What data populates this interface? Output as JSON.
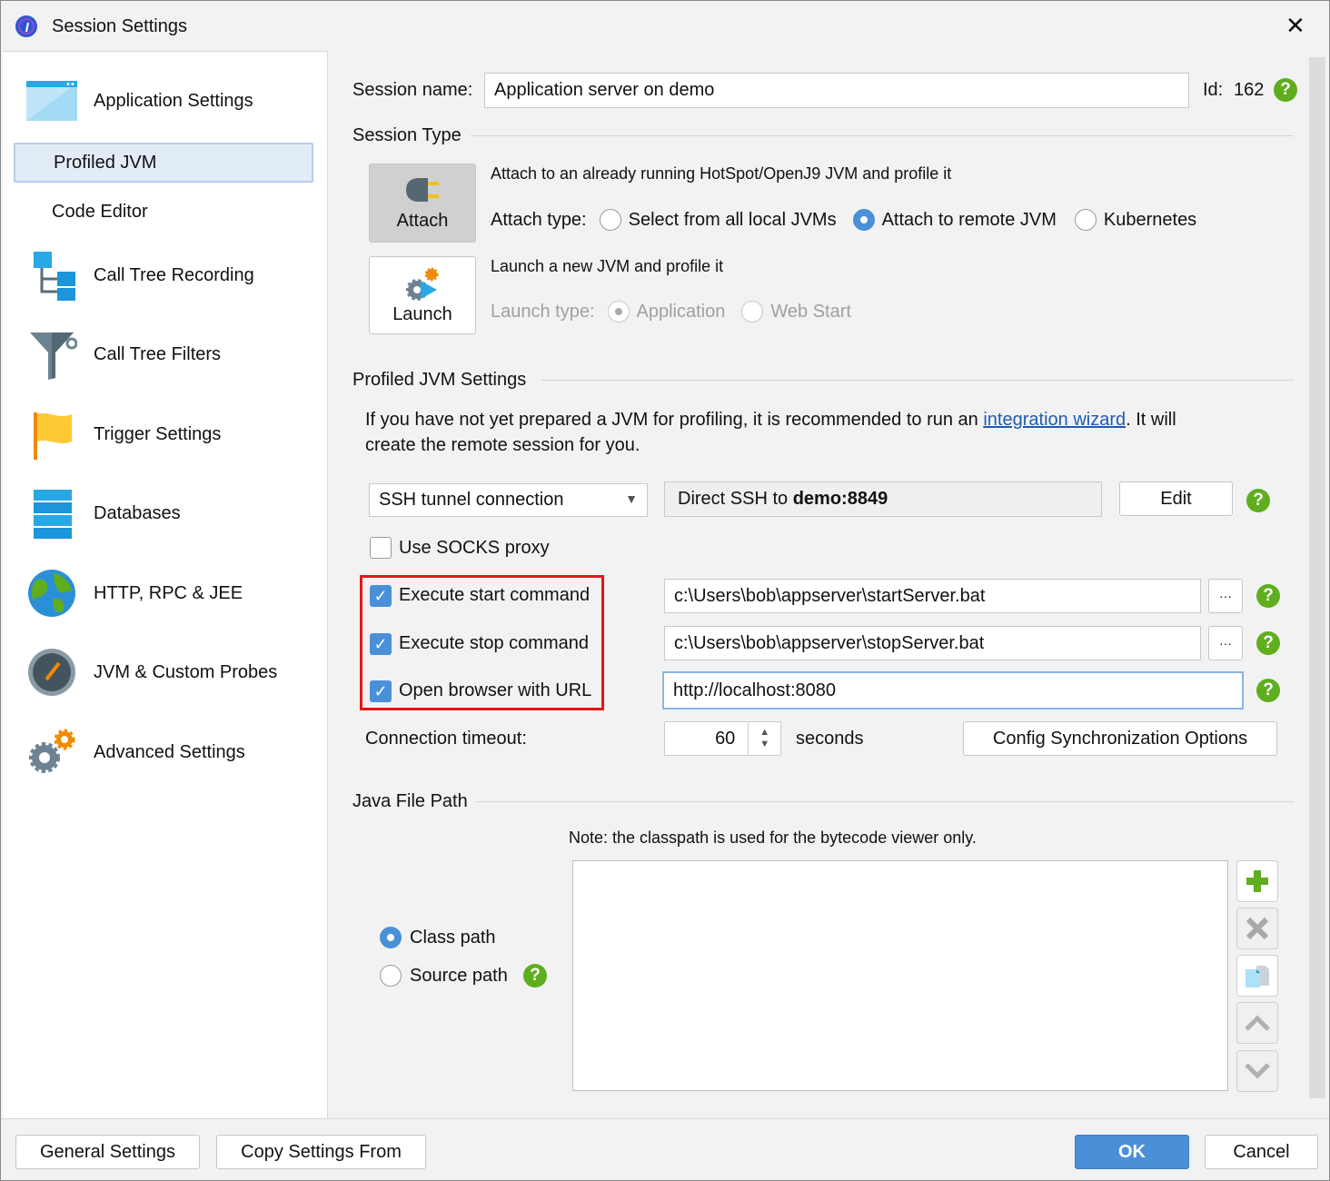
{
  "window": {
    "title": "Session Settings",
    "close": "✕"
  },
  "sidebar": {
    "items": [
      {
        "label": "Application Settings",
        "icon": "application-window-icon"
      },
      {
        "label": "Profiled JVM",
        "selected": true
      },
      {
        "label": "Code Editor"
      },
      {
        "label": "Call Tree Recording",
        "icon": "call-tree-icon"
      },
      {
        "label": "Call Tree Filters",
        "icon": "funnel-icon"
      },
      {
        "label": "Trigger Settings",
        "icon": "flag-icon"
      },
      {
        "label": "Databases",
        "icon": "database-icon"
      },
      {
        "label": "HTTP, RPC & JEE",
        "icon": "globe-icon"
      },
      {
        "label": "JVM & Custom Probes",
        "icon": "gauge-icon"
      },
      {
        "label": "Advanced Settings",
        "icon": "gears-icon"
      }
    ]
  },
  "session": {
    "name_label": "Session name:",
    "name_value": "Application server on demo",
    "id_label": "Id:",
    "id_value": "162"
  },
  "session_type": {
    "heading": "Session Type",
    "attach_button": "Attach",
    "launch_button": "Launch",
    "attach_desc": "Attach to an already running HotSpot/OpenJ9 JVM and profile it",
    "attach_type_label": "Attach type:",
    "attach_options": [
      "Select from all local JVMs",
      "Attach to remote JVM",
      "Kubernetes"
    ],
    "attach_selected": "Attach to remote JVM",
    "launch_desc": "Launch a new JVM and profile it",
    "launch_type_label": "Launch type:",
    "launch_options": [
      "Application",
      "Web Start"
    ]
  },
  "jvm_settings": {
    "heading": "Profiled JVM Settings",
    "info_before": "If you have not yet prepared a JVM for profiling, it is recommended to run an ",
    "info_link": "integration wizard",
    "info_after": ". It will",
    "info_line2": "create the remote session for you.",
    "connection_type": "SSH tunnel connection",
    "connection_prefix": "Direct SSH to ",
    "connection_host": "demo:8849",
    "edit_button": "Edit",
    "socks_label": "Use SOCKS proxy",
    "socks_checked": false,
    "start_label": "Execute start command",
    "start_value": "c:\\Users\\bob\\appserver\\startServer.bat",
    "stop_label": "Execute stop command",
    "stop_value": "c:\\Users\\bob\\appserver\\stopServer.bat",
    "browser_label": "Open browser with URL",
    "browser_value": "http://localhost:8080",
    "browse_button": "···",
    "timeout_label": "Connection timeout:",
    "timeout_value": "60",
    "timeout_unit": "seconds",
    "sync_button": "Config Synchronization Options"
  },
  "java_path": {
    "heading": "Java File Path",
    "note": "Note: the classpath is used for the bytecode viewer only.",
    "class_path": "Class path",
    "source_path": "Source path",
    "selected": "Class path"
  },
  "footer": {
    "general": "General Settings",
    "copy": "Copy Settings From",
    "ok": "OK",
    "cancel": "Cancel"
  },
  "colors": {
    "accent": "#4a90d9",
    "help": "#5fae1e",
    "highlight": "#e8141b"
  }
}
